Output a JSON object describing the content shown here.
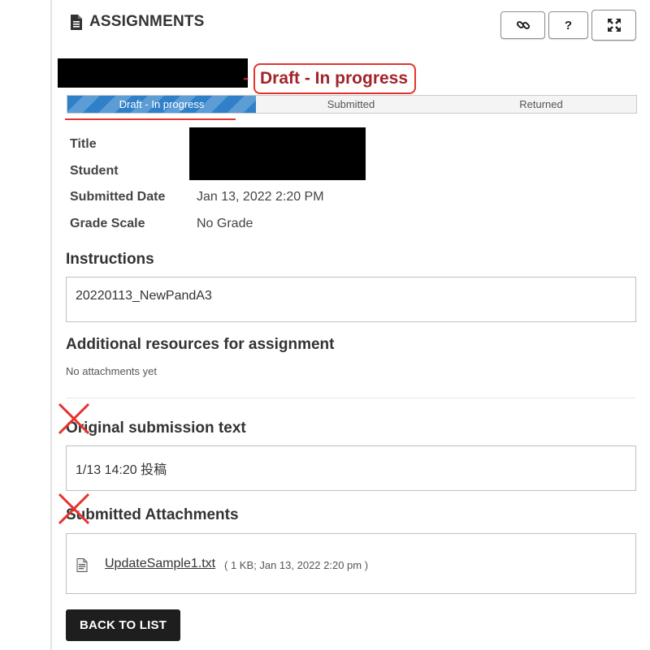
{
  "header": {
    "title": "ASSIGNMENTS",
    "buttons": {
      "link_icon": "link-icon",
      "help_label": "?",
      "fullscreen_icon": "expand-icon"
    }
  },
  "status": {
    "dash": "-",
    "label": "Draft - In progress"
  },
  "progress": {
    "steps": [
      "Draft - In progress",
      "Submitted",
      "Returned"
    ],
    "active_index": 0
  },
  "details": {
    "title_label": "Title",
    "student_label": "Student",
    "submitted_date_label": "Submitted Date",
    "submitted_date_value": "Jan 13, 2022 2:20 PM",
    "grade_scale_label": "Grade Scale",
    "grade_scale_value": "No Grade"
  },
  "instructions": {
    "heading": "Instructions",
    "text": "20220113_NewPandA3"
  },
  "resources": {
    "heading": "Additional resources for assignment",
    "empty_text": "No attachments yet"
  },
  "submission": {
    "heading": "Original submission text",
    "text": "1/13 14:20 投稿"
  },
  "attachments": {
    "heading": "Submitted Attachments",
    "file_name": "UpdateSample1.txt",
    "file_meta": "( 1 KB; Jan 13, 2022 2:20 pm )"
  },
  "footer": {
    "back_label": "BACK TO LIST"
  },
  "colors": {
    "accent_red": "#a3232a",
    "annotation_red": "#e4342f",
    "progress_blue": "#2f80c8",
    "button_dark": "#1e1e1e"
  }
}
